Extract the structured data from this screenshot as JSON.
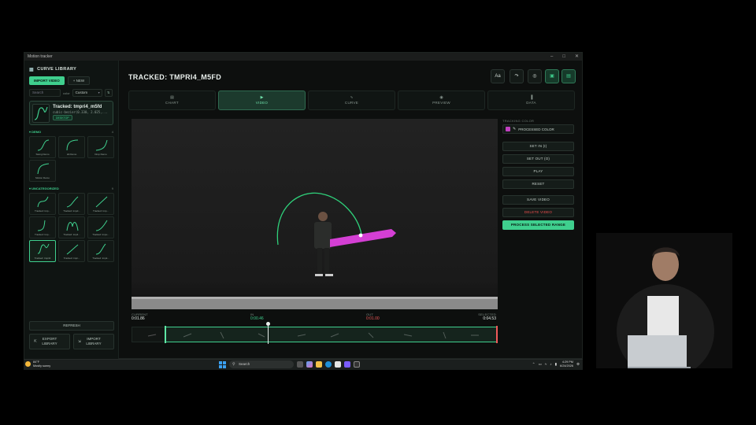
{
  "window": {
    "title": "Motion tracker",
    "controls": [
      "–",
      "□",
      "✕"
    ]
  },
  "sidebar": {
    "title": "CURVE LIBRARY",
    "import_video": "IMPORT VIDEO",
    "new": "+ NEW",
    "search_placeholder": "Search",
    "color_label": "color",
    "color_value": "Custom",
    "sort_glyph": "⇅",
    "selected": {
      "name": "Tracked: tmpri4_m5fd",
      "formula": "cubic-bezier(0.330, 2.025,...",
      "tag": "DESKTOP"
    },
    "demo": {
      "label": "DEMO",
      "count": "4",
      "items": [
        "Swing Demo",
        "Hit Demo",
        "Drop Demo",
        "Motion Demo"
      ]
    },
    "uncategorized": {
      "label": "UNCATEGORIZED",
      "count": "9",
      "items": [
        "Tracked: tmp...",
        "Tracked: tmpd...",
        "Tracked: tmp...",
        "Tracked: tmp...",
        "Tracked: tmpli...",
        "Tracked: tmpu...",
        "Tracked: tmpri4",
        "Tracked: tmpi...",
        "Tracked: tmpk..."
      ]
    },
    "refresh": "REFRESH",
    "export_line1": "EXPORT",
    "export_line2": "LIBRARY",
    "import_line1": "IMPORT",
    "import_line2": "LIBRARY"
  },
  "main": {
    "title": "TRACKED: TMPRI4_M5FD",
    "toolbar_icons": [
      "font-icon",
      "redo-icon",
      "target-icon",
      "save-icon",
      "layout-icon"
    ],
    "toolbar_glyphs": [
      "Aa",
      "↷",
      "◎",
      "▣",
      "▤"
    ],
    "tabs": [
      {
        "label": "CHART",
        "icon": "▤"
      },
      {
        "label": "VIDEO",
        "icon": "▶"
      },
      {
        "label": "CURVE",
        "icon": "∿"
      },
      {
        "label": "PREVIEW",
        "icon": "◉"
      },
      {
        "label": "DATA",
        "icon": "▐"
      }
    ],
    "active_tab": "VIDEO"
  },
  "controls": {
    "tracking_color_label": "TRACKING COLOR",
    "color_name": "PROCESSED COLOR",
    "set_in": "SET IN (I)",
    "set_out": "SET OUT (O)",
    "play": "PLAY",
    "reset": "RESET",
    "save_video": "SAVE VIDEO",
    "delete_video": "DELETE VIDEO",
    "process": "PROCESS SELECTED RANGE"
  },
  "timeline": {
    "current_label": "CURRENT",
    "current": "0:01.86",
    "in_label": "IN",
    "in": "0:00.46",
    "out_label": "OUT",
    "out": "0:01.00",
    "selected_label": "SELECTED",
    "selected": "0:04.53",
    "in_fraction": 0.09,
    "playhead_fraction": 0.37,
    "out_fraction": 1.0
  },
  "taskbar": {
    "temp": "84°F",
    "weather": "Mostly sunny",
    "search": "Search",
    "time": "4:29 PM",
    "date": "6/24/2026"
  },
  "colors": {
    "accent": "#3fcf8e",
    "danger": "#f04e4e",
    "tracking": "#c040c0"
  }
}
